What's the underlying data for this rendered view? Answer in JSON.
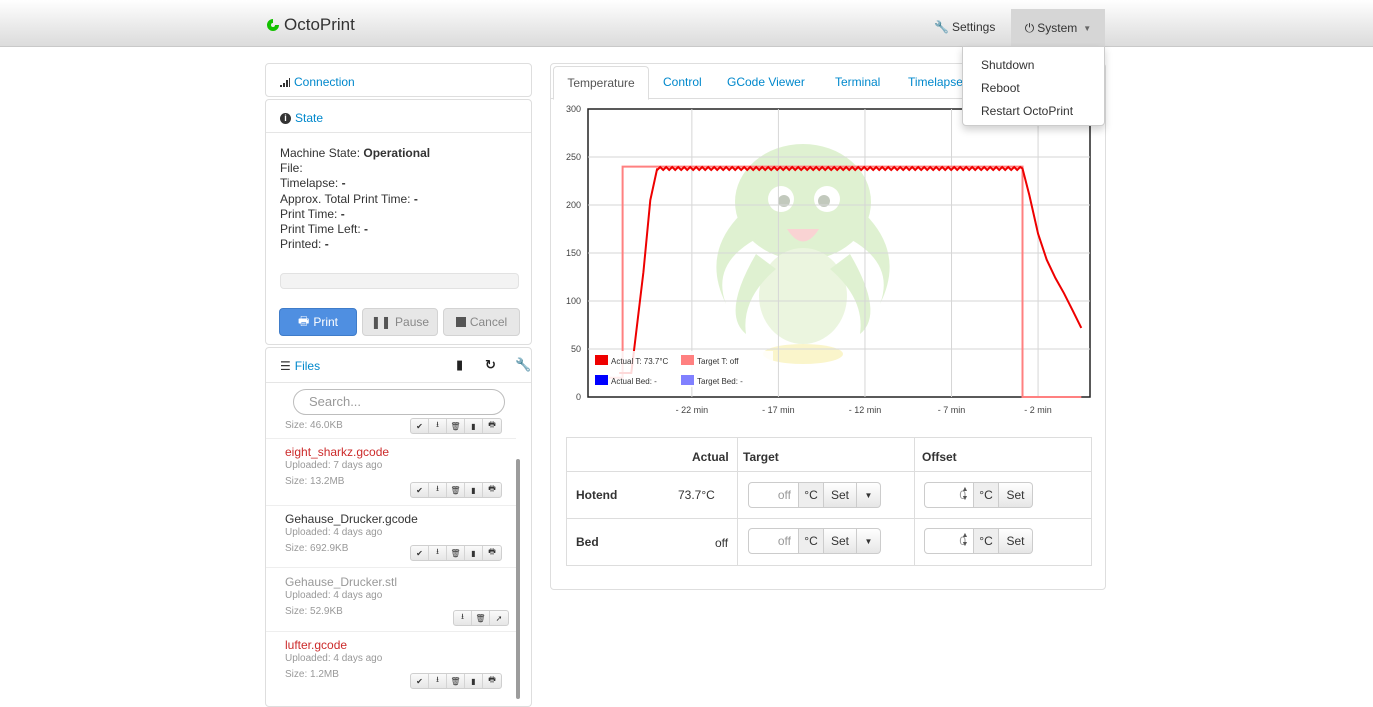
{
  "navbar": {
    "brand": "OctoPrint",
    "settings_label": "Settings",
    "system_label": "System",
    "system_menu": [
      "Shutdown",
      "Reboot",
      "Restart OctoPrint"
    ]
  },
  "sidebar": {
    "connection_title": "Connection",
    "state_title": "State",
    "state": {
      "machine_state_label": "Machine State:",
      "machine_state_value": "Operational",
      "file_label": "File:",
      "timelapse_label": "Timelapse:",
      "timelapse_value": "-",
      "approx_label": "Approx. Total Print Time:",
      "approx_value": "-",
      "print_time_label": "Print Time:",
      "print_time_value": "-",
      "print_time_left_label": "Print Time Left:",
      "print_time_left_value": "-",
      "printed_label": "Printed:",
      "printed_value": "-",
      "progress": 0
    },
    "buttons": {
      "print": "Print",
      "pause": "Pause",
      "cancel": "Cancel"
    },
    "files_title": "Files",
    "search_placeholder": "Search...",
    "files": [
      {
        "size": "Size: 46.0KB"
      },
      {
        "name": "eight_sharkz.gcode",
        "uploaded": "Uploaded: 7 days ago",
        "size": "Size: 13.2MB"
      },
      {
        "name": "Gehause_Drucker.gcode",
        "uploaded": "Uploaded: 4 days ago",
        "size": "Size: 692.9KB"
      },
      {
        "name": "Gehause_Drucker.stl",
        "uploaded": "Uploaded: 4 days ago",
        "size": "Size: 52.9KB"
      },
      {
        "name": "lufter.gcode",
        "uploaded": "Uploaded: 4 days ago",
        "size": "Size: 1.2MB"
      }
    ]
  },
  "tabs": [
    "Temperature",
    "Control",
    "GCode Viewer",
    "Terminal",
    "Timelapse"
  ],
  "chart_data": {
    "type": "line",
    "y_ticks": [
      "300",
      "250",
      "200",
      "150",
      "100",
      "50",
      "0"
    ],
    "x_ticks": [
      "- 22 min",
      "- 17 min",
      "- 12 min",
      "- 7 min",
      "- 2 min"
    ],
    "ylim": [
      0,
      300
    ],
    "grid": true,
    "legend_position": "bottom-left",
    "legend": [
      "Actual T: 73.7°C",
      "Target T: off",
      "Actual Bed: -",
      "Target Bed: -"
    ],
    "series": [
      {
        "name": "Actual T",
        "color": "#ee0000",
        "x": [
          -26.2,
          -25.5,
          -24.8,
          -24.4,
          -24.0,
          -2.9,
          -2.5,
          -2.0,
          -1.5,
          -1.0,
          -0.5,
          0.0,
          0.5
        ],
        "y": [
          25,
          25,
          130,
          205,
          238,
          238,
          210,
          170,
          143,
          124,
          108,
          90,
          72
        ]
      },
      {
        "name": "Target T",
        "color": "#ff8080",
        "x": [
          -26.8,
          -26.0,
          -26.0,
          -24.1,
          -24.1,
          -2.9,
          -2.9,
          0.5
        ],
        "y": [
          20,
          20,
          240,
          240,
          240,
          240,
          0,
          0
        ]
      },
      {
        "name": "Actual Bed",
        "color": "#0000ff",
        "x": [],
        "y": []
      },
      {
        "name": "Target Bed",
        "color": "#8080ff",
        "x": [],
        "y": []
      }
    ]
  },
  "temp_table": {
    "headers": [
      "Actual",
      "Target",
      "Offset"
    ],
    "rows": [
      {
        "label": "Hotend",
        "actual": "73.7°C",
        "target": "off",
        "offset": "0"
      },
      {
        "label": "Bed",
        "actual": "off",
        "target": "off",
        "offset": "0"
      }
    ],
    "unit": "°C",
    "set_label": "Set"
  }
}
